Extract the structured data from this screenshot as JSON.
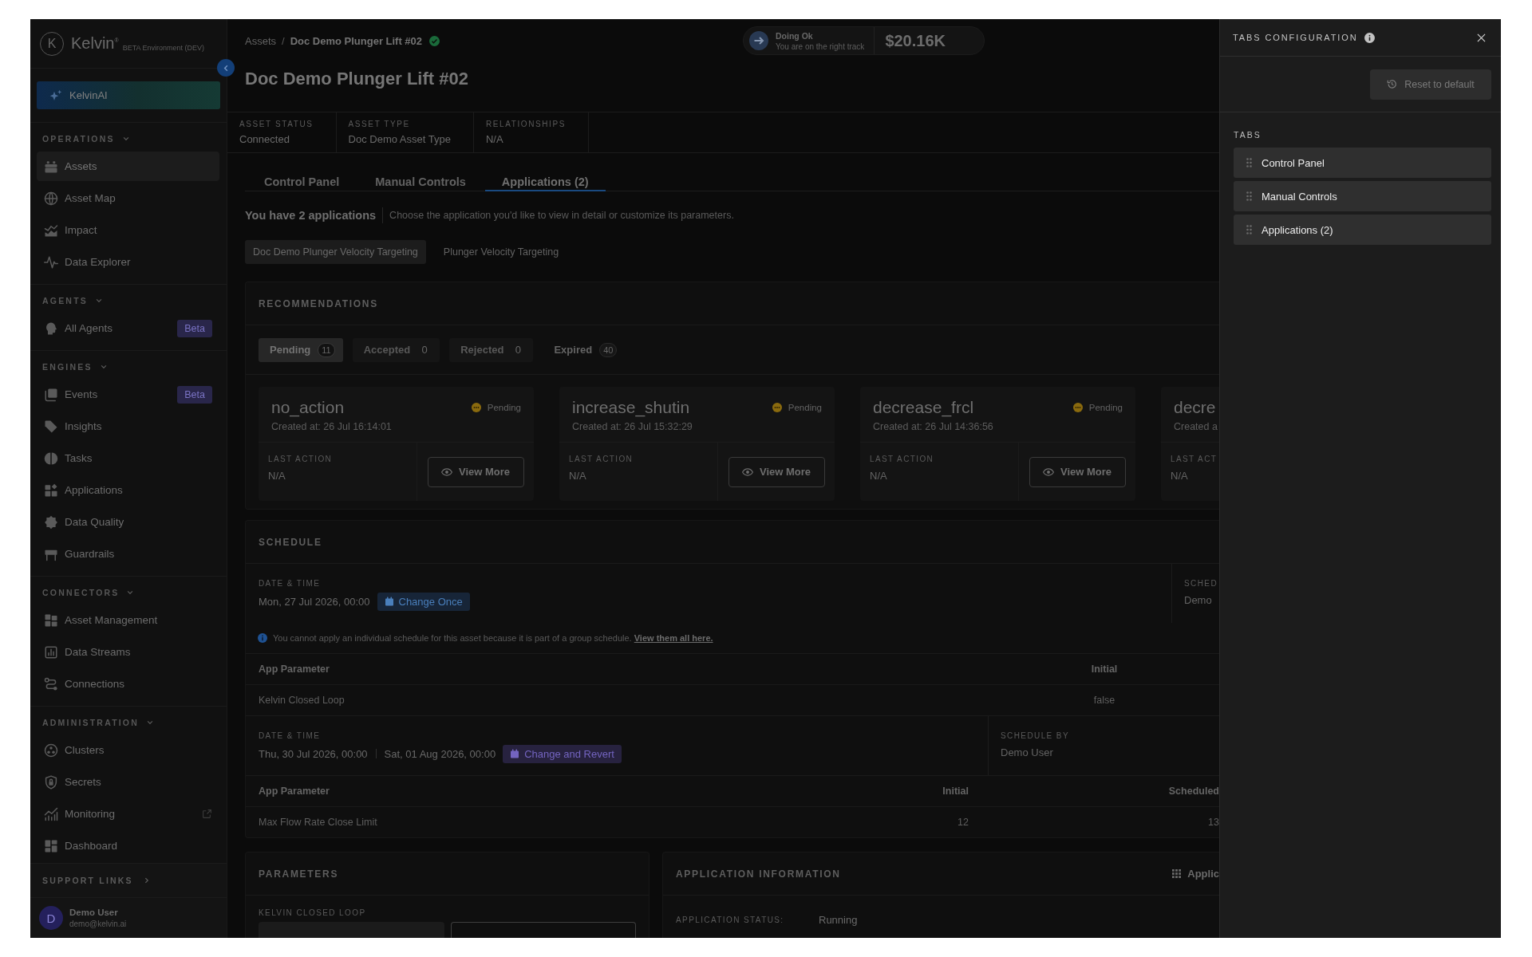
{
  "sidebar": {
    "logo": {
      "mark": "K",
      "name": "Kelvin$^{®}$",
      "environment": "BETA Environment (DEV)"
    },
    "ai_button": {
      "label": "KelvinAI"
    },
    "sections": [
      {
        "title": "OPERATIONS",
        "expanded": true,
        "items": [
          {
            "label": "Assets",
            "selected": true,
            "external": false
          },
          {
            "label": "Asset Map",
            "selected": false,
            "external": false
          },
          {
            "label": "Impact",
            "selected": false,
            "external": false
          },
          {
            "label": "Data Explorer",
            "selected": false,
            "external": false
          }
        ]
      },
      {
        "title": "AGENTS",
        "expanded": true,
        "items": [
          {
            "label": "All Agents",
            "badge": "Beta",
            "selected": false,
            "external": false
          }
        ]
      },
      {
        "title": "ENGINES",
        "expanded": true,
        "items": [
          {
            "label": "Events",
            "badge": "Beta",
            "selected": false,
            "external": false
          },
          {
            "label": "Insights",
            "selected": false,
            "external": false
          },
          {
            "label": "Tasks",
            "selected": false,
            "external": false
          },
          {
            "label": "Applications",
            "selected": false,
            "external": false
          },
          {
            "label": "Data Quality",
            "selected": false,
            "external": false
          },
          {
            "label": "Guardrails",
            "selected": false,
            "external": false
          }
        ]
      },
      {
        "title": "CONNECTORS",
        "expanded": true,
        "items": [
          {
            "label": "Asset Management",
            "selected": false,
            "external": false
          },
          {
            "label": "Data Streams",
            "selected": false,
            "external": false
          },
          {
            "label": "Connections",
            "selected": false,
            "external": false
          }
        ]
      },
      {
        "title": "ADMINISTRATION",
        "expanded": true,
        "items": [
          {
            "label": "Clusters",
            "selected": false,
            "external": false
          },
          {
            "label": "Secrets",
            "selected": false,
            "external": false
          },
          {
            "label": "Monitoring",
            "selected": false,
            "external": true
          },
          {
            "label": "Dashboard",
            "selected": false,
            "external": false
          }
        ]
      }
    ],
    "support_links": {
      "title": "SUPPORT LINKS",
      "expanded": false
    },
    "user": {
      "initial": "D",
      "name": "Demo User",
      "email": "demo@kelvin.ai"
    }
  },
  "breadcrumb": {
    "items": [
      "Assets",
      "Doc Demo Plunger Lift #02"
    ],
    "separator": "/",
    "verified": true
  },
  "status_pill": {
    "title": "Doing Ok",
    "subtitle": "You are on the right track",
    "value": "$20.16K"
  },
  "title": "Doc Demo Plunger Lift #02",
  "info": [
    {
      "label": "ASSET STATUS",
      "value": "Connected"
    },
    {
      "label": "ASSET TYPE",
      "value": "Doc Demo Asset Type"
    },
    {
      "label": "RELATIONSHIPS",
      "value": "N/A"
    }
  ],
  "tabs": [
    {
      "label": "Control Panel",
      "selected": false
    },
    {
      "label": "Manual Controls",
      "selected": false
    },
    {
      "label": "Applications (2)",
      "selected": true
    }
  ],
  "applications": {
    "summary": "You have 2 applications",
    "hint": "Choose the application you'd like to view in detail or customize its parameters.",
    "items": [
      {
        "label": "Doc Demo Plunger Velocity Targeting",
        "selected": true
      },
      {
        "label": "Plunger Velocity Targeting",
        "selected": false
      }
    ]
  },
  "recommendations": {
    "title": "RECOMMENDATIONS",
    "filters": [
      {
        "label": "Pending",
        "count": "11",
        "selected": true,
        "disabled": false
      },
      {
        "label": "Accepted",
        "count": "0",
        "selected": false,
        "disabled": true
      },
      {
        "label": "Rejected",
        "count": "0",
        "selected": false,
        "disabled": true
      },
      {
        "label": "Expired",
        "count": "40",
        "selected": false,
        "disabled": false
      }
    ],
    "cards": [
      {
        "name": "no_action",
        "status": "Pending",
        "kind": "pending",
        "created": "Created at: 26 Jul 16:14:01",
        "last_action_label": "LAST ACTION",
        "last_action": "N/A",
        "button": "View More"
      },
      {
        "name": "increase_shutin",
        "status": "Pending",
        "kind": "pending",
        "created": "Created at: 26 Jul 15:32:29",
        "last_action_label": "LAST ACTION",
        "last_action": "N/A",
        "button": "View More"
      },
      {
        "name": "decrease_frcl",
        "status": "Pending",
        "kind": "pending",
        "created": "Created at: 26 Jul 14:36:56",
        "last_action_label": "LAST ACTION",
        "last_action": "N/A",
        "button": "View More"
      },
      {
        "name": "decre",
        "created": "Created a",
        "last_action_label": "LAST ACT",
        "last_action": "N/A"
      }
    ]
  },
  "schedule": {
    "title": "SCHEDULE",
    "entries": [
      {
        "kind": "once",
        "date_label": "DATE & TIME",
        "dates": [
          "Mon, 27 Jul 2026, 00:00"
        ],
        "action": "Change Once",
        "side_label": "SCHED",
        "side_value": "Demo",
        "notice": {
          "text": "You cannot apply an individual schedule for this asset because it is part of a group schedule.",
          "link": "View them all here."
        },
        "table": {
          "columns": [
            "App Parameter",
            "Initial"
          ],
          "rows": [
            [
              "Kelvin Closed Loop",
              "false"
            ]
          ]
        }
      },
      {
        "kind": "revert",
        "date_label": "DATE & TIME",
        "dates": [
          "Thu, 30 Jul 2026, 00:00",
          "Sat, 01 Aug 2026, 00:00"
        ],
        "action": "Change and Revert",
        "side_label": "SCHEDULE BY",
        "side_value": "Demo User",
        "table": {
          "columns": [
            "App Parameter",
            "Initial",
            "Scheduled"
          ],
          "rows": [
            [
              "Max Flow Rate Close Limit",
              "12",
              "13"
            ]
          ]
        }
      }
    ]
  },
  "parameters": {
    "title": "PARAMETERS",
    "field_label": "KELVIN CLOSED LOOP",
    "inputs": [
      {
        "kind": "select"
      },
      {
        "kind": "text"
      }
    ]
  },
  "app_info": {
    "title": "APPLICATION INFORMATION",
    "button": "Applic",
    "status_label": "APPLICATION STATUS:",
    "status": "Running"
  },
  "tabs_config": {
    "title": "TABS CONFIGURATION",
    "reset": {
      "label": "Reset to default",
      "disabled": true
    },
    "section": "TABS",
    "items": [
      {
        "label": "Control Panel"
      },
      {
        "label": "Manual Controls"
      },
      {
        "label": "Applications (2)"
      }
    ]
  }
}
